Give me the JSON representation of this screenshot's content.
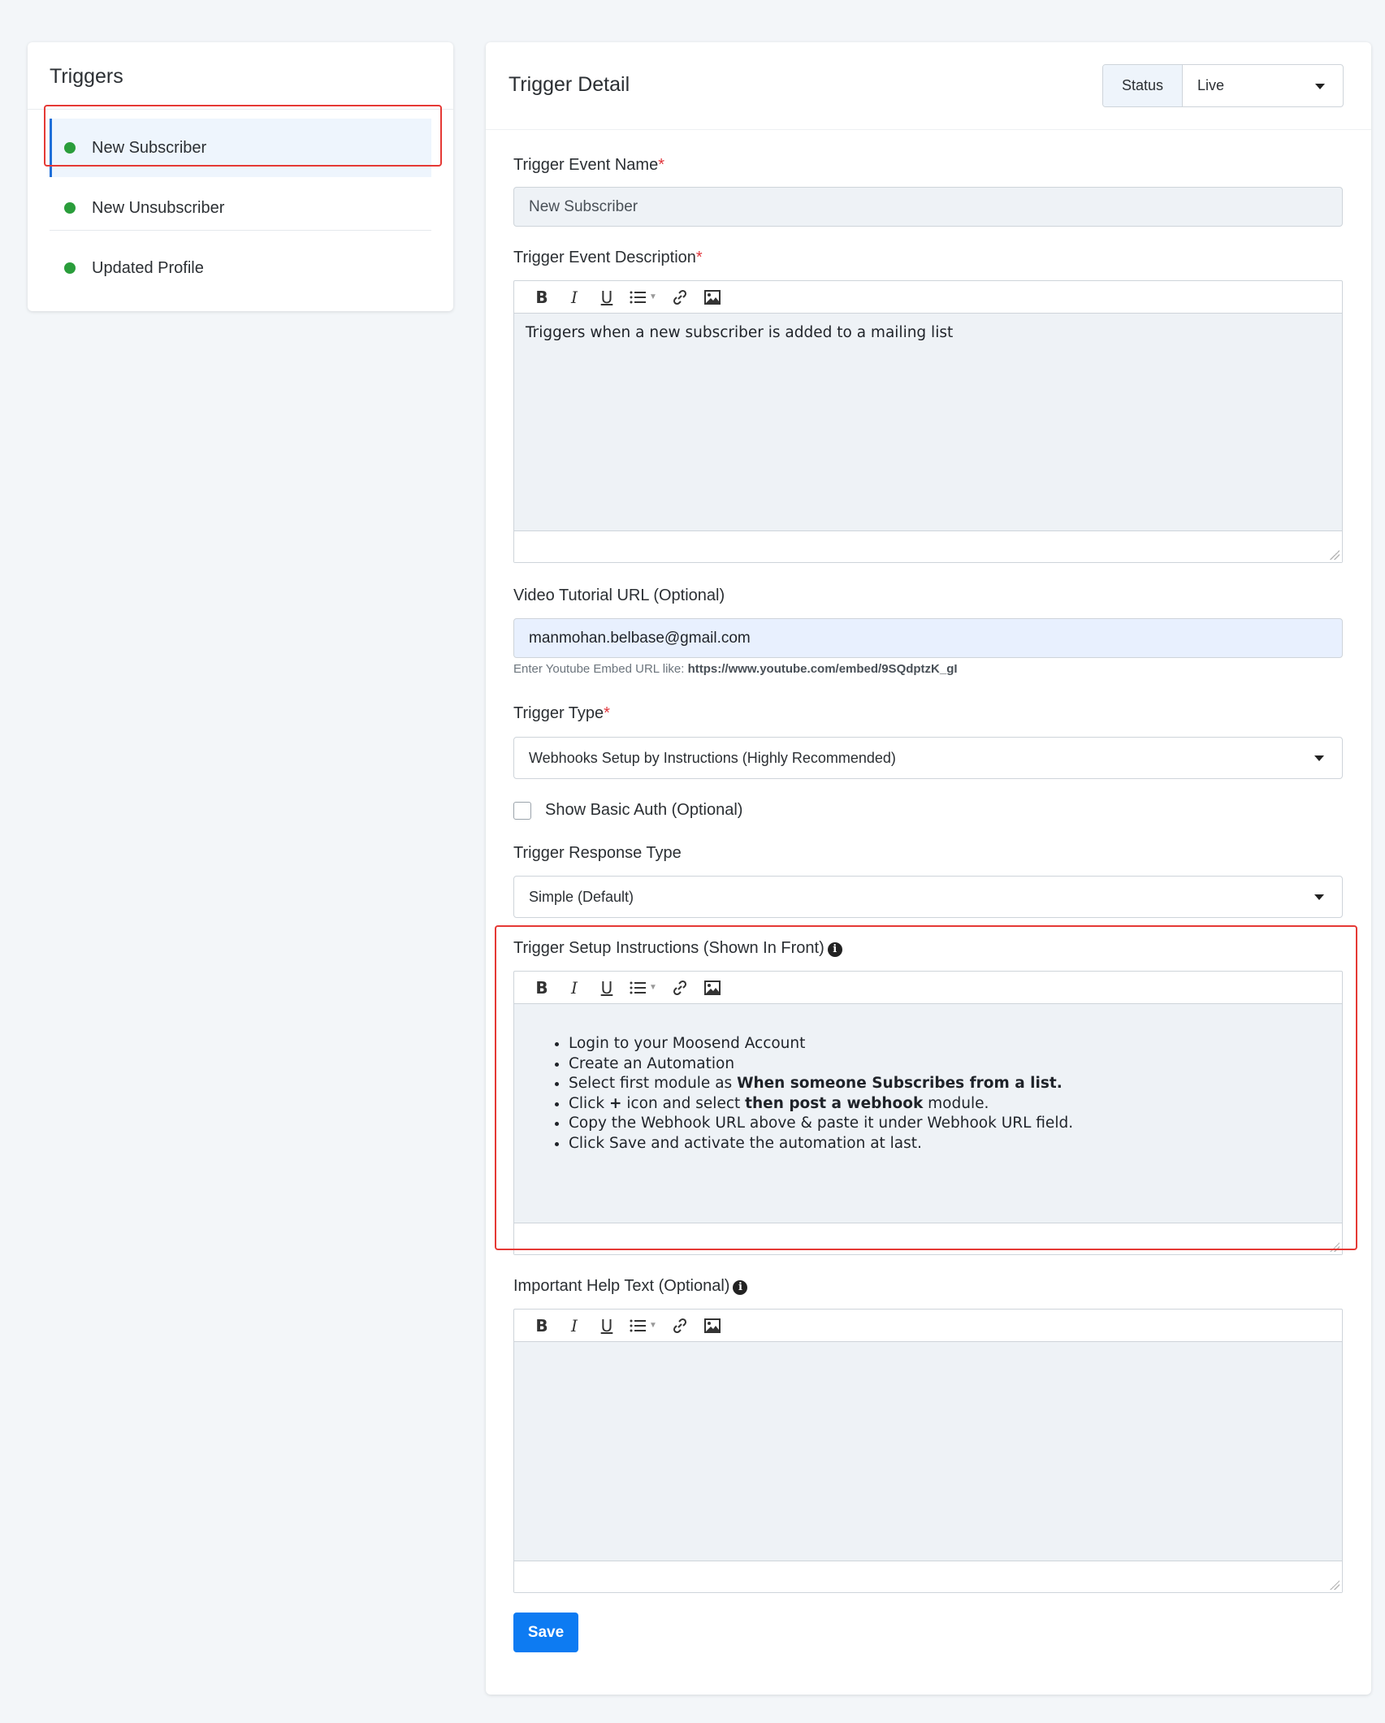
{
  "sidebar": {
    "title": "Triggers",
    "items": [
      {
        "label": "New Subscriber",
        "status": "active"
      },
      {
        "label": "New Unsubscriber",
        "status": "active"
      },
      {
        "label": "Updated Profile",
        "status": "active"
      }
    ]
  },
  "detail": {
    "title": "Trigger Detail",
    "status_label": "Status",
    "status_value": "Live",
    "event_name_label": "Trigger Event Name",
    "event_name_value": "New Subscriber",
    "required_mark": "*",
    "event_desc_label": "Trigger Event Description",
    "event_desc_value": "Triggers when a new subscriber is added to a mailing list",
    "video_label": "Video Tutorial URL (Optional)",
    "video_value": "manmohan.belbase@gmail.com",
    "video_help_prefix": "Enter Youtube Embed URL like:",
    "video_help_url": "https://www.youtube.com/embed/9SQdptzK_gI",
    "trigger_type_label": "Trigger Type",
    "trigger_type_value": "Webhooks Setup by Instructions (Highly Recommended)",
    "basic_auth_label": "Show Basic Auth (Optional)",
    "response_type_label": "Trigger Response Type",
    "response_type_value": "Simple (Default)",
    "instructions_label": "Trigger Setup Instructions (Shown In Front)",
    "instructions": {
      "li1": "Login to your Moosend Account",
      "li2": "Create an Automation",
      "li3_pre": "Select first module as ",
      "li3_bold": "When someone Subscribes from a list.",
      "li4_pre": "Click ",
      "li4_icon": "+",
      "li4_mid": " icon and select ",
      "li4_bold": "then post a webhook",
      "li4_post": " module.",
      "li5": "Copy the Webhook URL above & paste it under Webhook URL field.",
      "li6": "Click Save and activate the automation at last."
    },
    "help_text_label": "Important Help Text (Optional)",
    "help_text_value": "",
    "save_label": "Save"
  },
  "toolbar": {
    "bold": "B",
    "italic": "I",
    "underline": "U"
  },
  "colors": {
    "accent": "#0d7bf2",
    "status_dot": "#2a9d3b",
    "highlight": "#e53935"
  }
}
